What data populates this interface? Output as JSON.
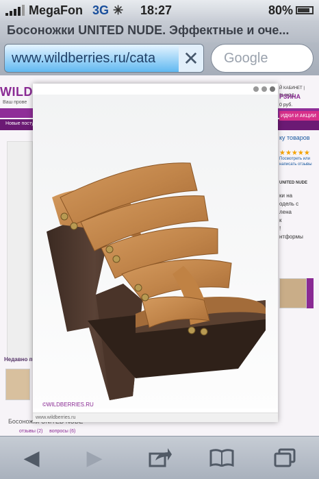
{
  "status_bar": {
    "carrier": "MegaFon",
    "network": "3G",
    "time": "18:27",
    "battery": "80%"
  },
  "browser": {
    "page_title": "Босоножки UNITED NUDE. Эффектные и оче...",
    "url": "www.wildberries.ru/cata",
    "search_placeholder": "Google"
  },
  "background_page": {
    "logo": "WILD",
    "subtitle": "Ваш прове",
    "nav_text": "Новые посту",
    "recent_label": "Недавно пр",
    "bottom_text": "Босоножки UNITED NUDE",
    "tab_reviews": "отзывы (2)",
    "tab_questions": "вопросы (6)",
    "right_panel": {
      "cabinet": "Й КАБИНЕТ | ВЫХОД",
      "cart": "РЗИНА",
      "cart_sum": "0 руб.",
      "sale": "ИДКИ И АКЦИИ",
      "list": "ку товаров",
      "review_link": "Посмотреть или написать отзывы",
      "brand": "UNITED NUDE",
      "desc": [
        "ки на",
        "одель с",
        "лена",
        "к",
        "нтформы"
      ],
      "excl": "!"
    }
  },
  "popup": {
    "watermark": "©WILDBERRIES.RU",
    "caption": "www.wildberries.ru",
    "image_subject": "wedge-sandal"
  },
  "toolbar": {
    "back_icon": "back-arrow-icon",
    "forward_icon": "forward-arrow-icon",
    "share_icon": "share-icon",
    "bookmarks_icon": "bookmarks-icon",
    "tabs_icon": "tabs-icon"
  },
  "colors": {
    "brand": "#8a2a94",
    "url_highlight": "#61b9f1"
  }
}
